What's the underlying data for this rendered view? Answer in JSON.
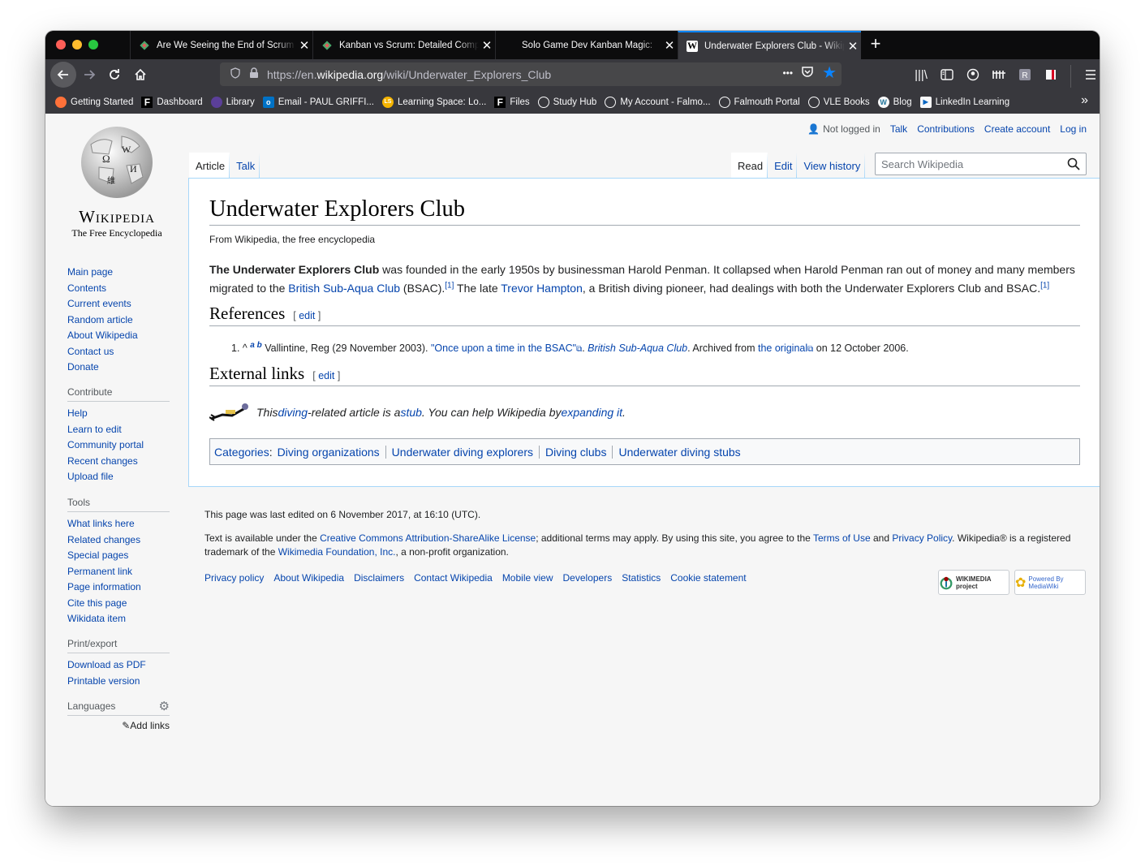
{
  "browser": {
    "tabs": [
      {
        "title": "Are We Seeing the End of Scrum",
        "active": false
      },
      {
        "title": "Kanban vs Scrum: Detailed Comparison",
        "active": false
      },
      {
        "title": "Solo Game Dev Kanban Magic: ",
        "active": false
      },
      {
        "title": "Underwater Explorers Club - Wikipedia",
        "active": true
      }
    ],
    "url_prefix": "https://en.",
    "url_domain": "wikipedia.org",
    "url_path": "/wiki/Underwater_Explorers_Club",
    "url_menu": "•••",
    "bookmarks": [
      "Getting Started",
      "Dashboard",
      "Library",
      "Email - PAUL GRIFFI...",
      "Learning Space: Lo...",
      "Files",
      "Study Hub",
      "My Account - Falmo...",
      "Falmouth Portal",
      "VLE Books",
      "Blog",
      "LinkedIn Learning"
    ],
    "bookmarks_more": "»"
  },
  "logo": {
    "wordmark": "Wikipedia",
    "tagline": "The Free Encyclopedia"
  },
  "sidebar": {
    "navigation": [
      "Main page",
      "Contents",
      "Current events",
      "Random article",
      "About Wikipedia",
      "Contact us",
      "Donate"
    ],
    "contribute": {
      "heading": "Contribute",
      "items": [
        "Help",
        "Learn to edit",
        "Community portal",
        "Recent changes",
        "Upload file"
      ]
    },
    "tools": {
      "heading": "Tools",
      "items": [
        "What links here",
        "Related changes",
        "Special pages",
        "Permanent link",
        "Page information",
        "Cite this page",
        "Wikidata item"
      ]
    },
    "print": {
      "heading": "Print/export",
      "items": [
        "Download as PDF",
        "Printable version"
      ]
    },
    "languages": {
      "heading": "Languages",
      "add_links": "Add links"
    }
  },
  "personal": {
    "not_logged_in": "Not logged in",
    "talk": "Talk",
    "contributions": "Contributions",
    "create_account": "Create account",
    "log_in": "Log in"
  },
  "page_tabs": {
    "article": "Article",
    "talk": "Talk",
    "read": "Read",
    "edit": "Edit",
    "history": "View history"
  },
  "search": {
    "placeholder": "Search Wikipedia"
  },
  "article": {
    "title": "Underwater Explorers Club",
    "subtitle": "From Wikipedia, the free encyclopedia",
    "p_bold": "The Underwater Explorers Club",
    "p_1": " was founded in the early 1950s by businessman Harold Penman. It collapsed when Harold Penman ran out of money and many members migrated to the ",
    "link_bsac": "British Sub-Aqua Club",
    "p_2": " (BSAC).",
    "cite": "[1]",
    "p_3": " The late ",
    "link_trevor": "Trevor Hampton",
    "p_4": ", a British diving pioneer, had dealings with both the Underwater Explorers Club and BSAC.",
    "references_heading": "References",
    "edit_label": "edit",
    "ref_num": "1.",
    "ref_caret": "^",
    "ref_a": "a",
    "ref_b": "b",
    "ref_text1": " Vallintine, Reg (29 November 2003). ",
    "ref_link1": "\"Once upon a time in the BSAC\"",
    "ref_text2": ". ",
    "ref_work": "British Sub-Aqua Club",
    "ref_text3": ". Archived from ",
    "ref_link2": "the original",
    "ref_text4": " on 12 October 2006.",
    "external_heading": "External links",
    "stub_1": "This ",
    "stub_link1": "diving",
    "stub_2": "-related article is a ",
    "stub_link2": "stub",
    "stub_3": ". You can help Wikipedia by ",
    "stub_link3": "expanding it",
    "stub_4": ".",
    "categories_label": "Categories",
    "categories": [
      "Diving organizations",
      "Underwater diving explorers",
      "Diving clubs",
      "Underwater diving stubs"
    ]
  },
  "footer": {
    "last_edited": "This page was last edited on 6 November 2017, at 16:10 (UTC).",
    "license_1": "Text is available under the ",
    "license_link": "Creative Commons Attribution-ShareAlike License",
    "license_2": "; additional terms may apply. By using this site, you agree to the ",
    "terms_link": "Terms of Use",
    "license_3": " and ",
    "privacy_link": "Privacy Policy",
    "license_4": ". Wikipedia® is a registered trademark of the ",
    "foundation_link": "Wikimedia Foundation, Inc.",
    "license_5": ", a non-profit organization.",
    "links": [
      "Privacy policy",
      "About Wikipedia",
      "Disclaimers",
      "Contact Wikipedia",
      "Mobile view",
      "Developers",
      "Statistics",
      "Cookie statement"
    ],
    "badge_wikimedia": "WIKIMEDIA project",
    "badge_mediawiki": "Powered By MediaWiki"
  }
}
